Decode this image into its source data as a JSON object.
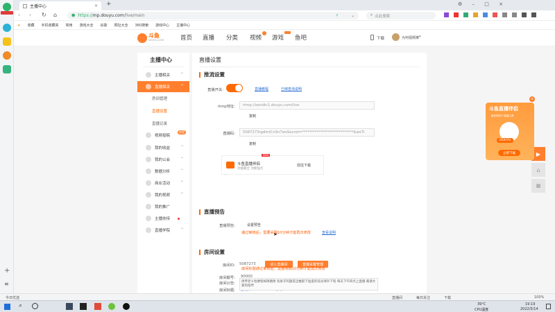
{
  "browser": {
    "tab_title": "主播中心",
    "url_prefix": "https://",
    "url_host": "mp.douyu.com",
    "url_path": "/live/main",
    "search_placeholder": "点此搜索",
    "bookmarks": [
      "收藏",
      "手机收藏夹",
      "常用",
      "游戏大全",
      "谷歌",
      "网址大全",
      "360搜索",
      "游戏中心",
      "主播中心"
    ]
  },
  "header": {
    "logo_text": "斗鱼",
    "logo_sub": "DOUYU.COM",
    "nav": [
      "首页",
      "直播",
      "分类",
      "视频",
      "游戏",
      "鱼吧"
    ],
    "download": "下载",
    "user": "为何视频推"
  },
  "sidebar": {
    "title": "主播中心",
    "items": [
      {
        "label": "主播相关"
      },
      {
        "label": "直播相关"
      },
      {
        "label": "视频投稿"
      },
      {
        "label": "我的收益"
      },
      {
        "label": "我的公会"
      },
      {
        "label": "数据分析"
      },
      {
        "label": "商业活动"
      },
      {
        "label": "我的视频"
      },
      {
        "label": "我的推广"
      },
      {
        "label": "主播扶持"
      },
      {
        "label": "直播学院"
      }
    ],
    "subitems": [
      "房间管理",
      "直播设置",
      "直播记录"
    ],
    "new_badge": "新版"
  },
  "main": {
    "page_title": "直播设置",
    "push": {
      "title": "推流设置",
      "switch_label": "直播开关:",
      "tutorial_link": "直播教程",
      "announce_link": "已绑查询说明",
      "rtmp_label": "rtmp地址:",
      "rtmp_value": "rtmp://sendtc1.douyu.com/live",
      "copy1": "复制",
      "code_label": "直播码:",
      "code_value": "5087273rgdmtCn5n7wsSecret=****************************&wsTi",
      "copy2": "复制",
      "tool_title": "斗鱼直播伴侣",
      "tool_sub": "功能最全 功能强大",
      "tool_btn": "前往下载",
      "tool_new": "NEW"
    },
    "preview": {
      "title": "直播预告",
      "label": "直播预告:",
      "btn": "设置预告",
      "warn": "通过审核后，需要间隔10分钟才能再次修改",
      "link": "查看说明"
    },
    "room": {
      "title": "房间设置",
      "id_label": "房间ID:",
      "id_value": "5087273",
      "btn1": "进入直播间",
      "btn2": "直播设置管理",
      "num_label": "房间靓号:",
      "num_value": "90000",
      "name_label": "房间标题:",
      "name_value": "鱼吧旧1111",
      "name_btn": "修改",
      "name_warn": "房间标题通过审核后，需要间隔10分钟才能再次修改",
      "notice_label": "房间公告:",
      "notice_value": "周传老十粒硬程如简路情 有屏子的题友迈推取下鱼度的双光律升下现 每天下午四点上直播 邀请大家的陪伴"
    }
  },
  "promo": {
    "title": "斗鱼直播伴侣",
    "sub": "超优秀的PC直播工具",
    "btn": "立即下载",
    "logo": "DOUYU"
  },
  "status": {
    "left": "今日优选",
    "items": [
      "直播间",
      "每日关注",
      "下载"
    ],
    "zoom": "100%"
  },
  "taskbar": {
    "weather": "39°C",
    "cpu": "CPU温度",
    "time": "19:19",
    "date": "2022/5/14"
  },
  "colors": {
    "accent": "#ff7f2e",
    "link": "#2a6fd4",
    "warn": "#ff5a00"
  }
}
